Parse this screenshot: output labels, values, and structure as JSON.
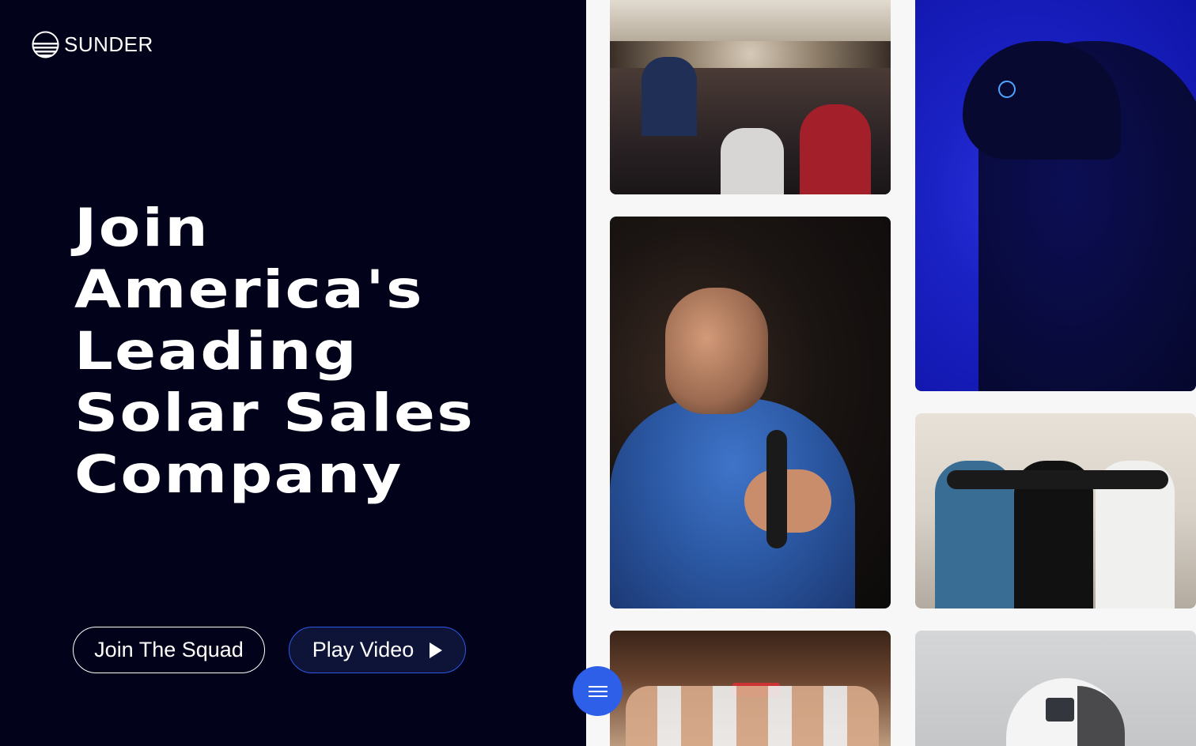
{
  "brand": {
    "name": "SUNDER",
    "logo_icon": "sunset-stripes-icon"
  },
  "hero": {
    "headline_lines": [
      "Join",
      "America's",
      "Leading",
      "Solar Sales",
      "Company"
    ]
  },
  "actions": {
    "join_label": "Join The Squad",
    "play_label": "Play Video",
    "play_icon": "play-icon",
    "menu_icon": "hamburger-menu-icon"
  },
  "colors": {
    "background_dark": "#02021a",
    "accent_blue": "#2e5fe8",
    "gallery_background": "#f7f7f7"
  }
}
